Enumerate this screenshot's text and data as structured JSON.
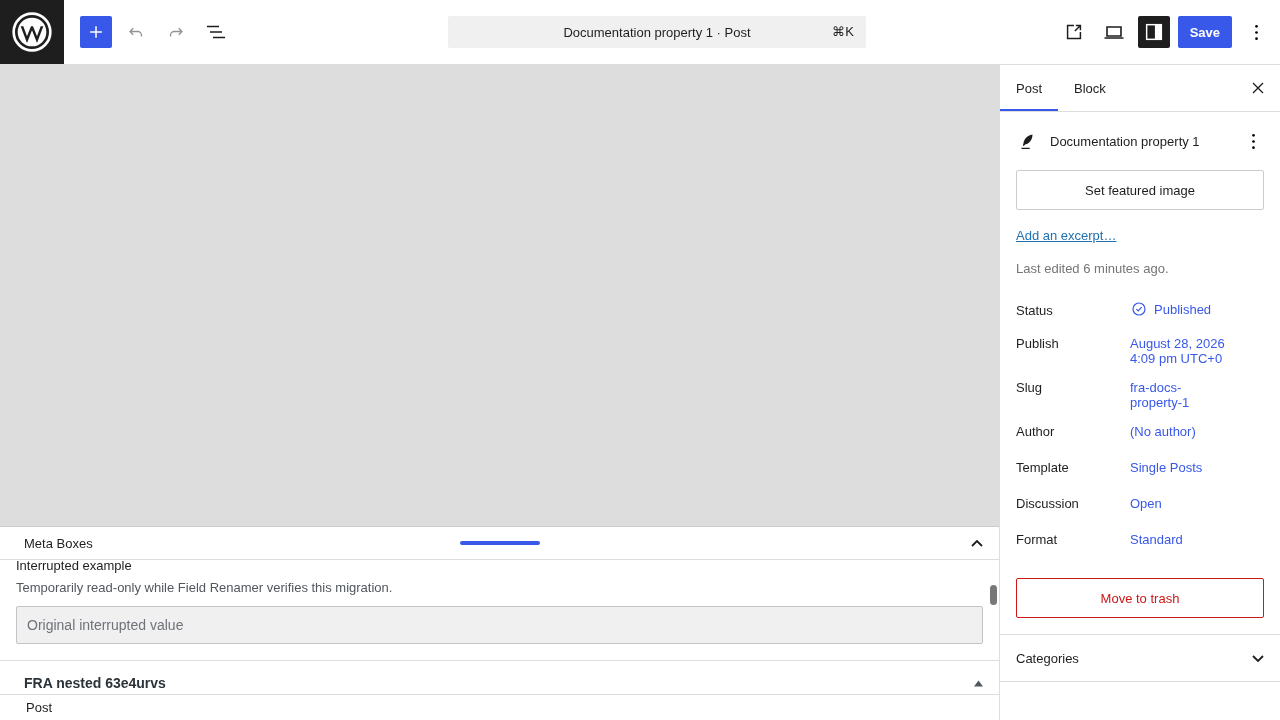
{
  "topbar": {
    "command_bar": {
      "title": "Documentation property 1 · Post",
      "shortcut": "⌘K"
    },
    "settings_toggle": {
      "on": true
    },
    "save_label": "Save"
  },
  "meta_boxes": {
    "title": "Meta Boxes",
    "expanded": true,
    "field": {
      "label": "Interrupted example",
      "help": "Temporarily read-only while Field Renamer verifies this migration.",
      "value": "Original interrupted value",
      "disabled": true
    },
    "next_box": {
      "title": "FRA nested 63e4urvs",
      "expanded": true
    }
  },
  "footer": {
    "breadcrumb": "Post"
  },
  "sidebar": {
    "tabs": [
      {
        "label": "Post",
        "selected": true
      },
      {
        "label": "Block",
        "selected": false
      }
    ],
    "post_title": "Documentation property 1",
    "featured_image_button": "Set featured image",
    "excerpt_link": "Add an excerpt…",
    "last_edited": "Last edited 6 minutes ago.",
    "rows": [
      {
        "label": "Status",
        "value": "Published",
        "kind": "status"
      },
      {
        "label": "Publish",
        "value": "August 28, 2026 4:09 pm UTC+0",
        "kind": "link"
      },
      {
        "label": "Slug",
        "value": "fra-docs-property-1",
        "kind": "link"
      },
      {
        "label": "Author",
        "value": "(No author)",
        "kind": "link"
      },
      {
        "label": "Template",
        "value": "Single Posts",
        "kind": "link"
      },
      {
        "label": "Discussion",
        "value": "Open",
        "kind": "link"
      },
      {
        "label": "Format",
        "value": "Standard",
        "kind": "link"
      }
    ],
    "trash_button": "Move to trash",
    "panels": [
      {
        "title": "Categories",
        "expanded": false
      }
    ]
  }
}
